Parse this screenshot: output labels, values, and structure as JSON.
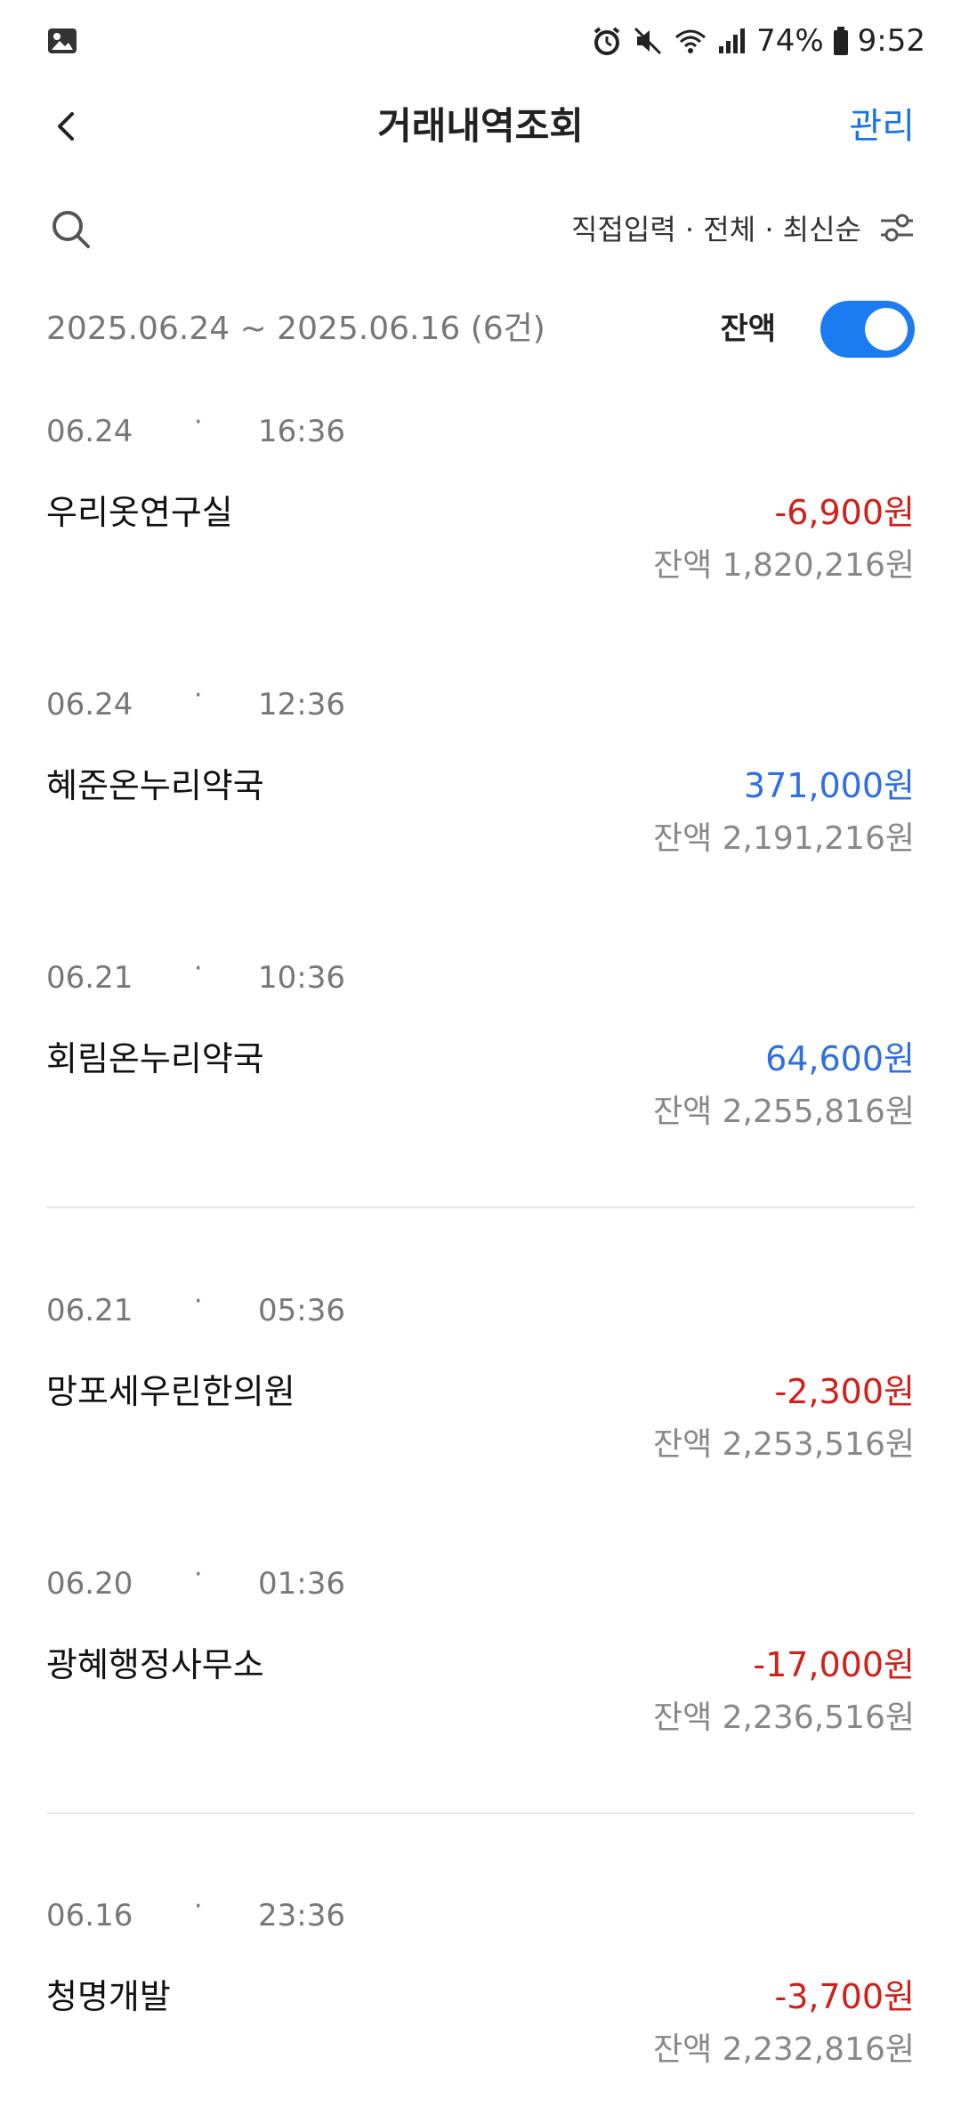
{
  "status_bar": {
    "battery_percent": "74%",
    "time": "9:52",
    "icons": [
      "gallery-icon",
      "alarm-icon",
      "mute-icon",
      "wifi-icon",
      "signal-icon",
      "battery-icon"
    ]
  },
  "header": {
    "title": "거래내역조회",
    "manage_label": "관리"
  },
  "filter": {
    "summary": "직접입력 · 전체 · 최신순"
  },
  "period": {
    "range": "2025.06.24 ~ 2025.06.16 (6건)",
    "balance_label": "잔액",
    "balance_toggle_on": true
  },
  "transactions": [
    {
      "date": "06.24",
      "time": "16:36",
      "name": "우리옷연구실",
      "amount": "-6,900원",
      "type": "neg",
      "balance": "잔액 1,820,216원"
    },
    {
      "date": "06.24",
      "time": "12:36",
      "name": "혜준온누리약국",
      "amount": "371,000원",
      "type": "pos",
      "balance": "잔액 2,191,216원"
    },
    {
      "date": "06.21",
      "time": "10:36",
      "name": "회림온누리약국",
      "amount": "64,600원",
      "type": "pos",
      "balance": "잔액 2,255,816원"
    },
    {
      "date": "06.21",
      "time": "05:36",
      "name": "망포세우린한의원",
      "amount": "-2,300원",
      "type": "neg",
      "balance": "잔액 2,253,516원"
    },
    {
      "date": "06.20",
      "time": "01:36",
      "name": "광혜행정사무소",
      "amount": "-17,000원",
      "type": "neg",
      "balance": "잔액 2,236,516원"
    },
    {
      "date": "06.16",
      "time": "23:36",
      "name": "청명개발",
      "amount": "-3,700원",
      "type": "neg",
      "balance": "잔액 2,232,816원"
    }
  ],
  "colors": {
    "accent": "#1a73e8",
    "negative": "#d0201a",
    "positive": "#2f6fe0",
    "toggle": "#1a7cf0"
  }
}
